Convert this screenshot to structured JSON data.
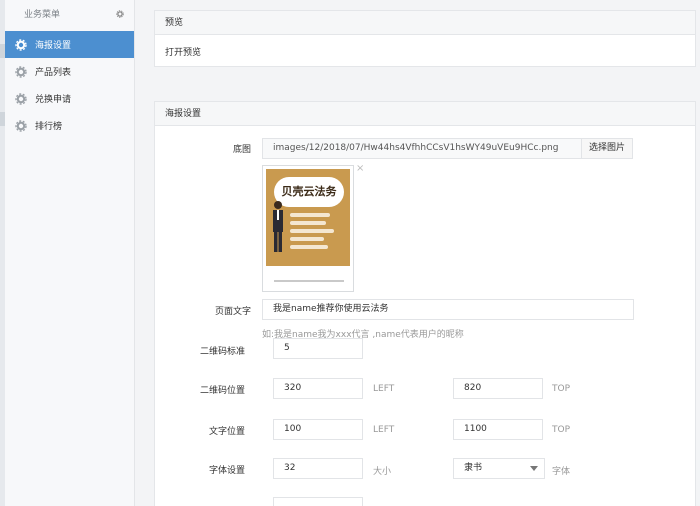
{
  "sidebar": {
    "header": "业务菜单",
    "items": [
      {
        "label": "海报设置",
        "active": true
      },
      {
        "label": "产品列表",
        "active": false
      },
      {
        "label": "兑换申请",
        "active": false
      },
      {
        "label": "排行榜",
        "active": false
      }
    ]
  },
  "preview_panel": {
    "title": "预览",
    "link": "打开预览"
  },
  "settings_panel": {
    "title": "海报设置",
    "background": {
      "label": "底图",
      "value": "images/12/2018/07/Hw44hs4VfhhCCsV1hsWY49uVEu9HCc.png",
      "button": "选择图片",
      "thumbnail_title": "贝壳云法务"
    },
    "page_text": {
      "label": "页面文字",
      "value": "我是name推荐你使用云法务",
      "help": "如:我是name我为xxx代言 ,name代表用户的昵称"
    },
    "qr_size": {
      "label": "二维码标准",
      "value": "5"
    },
    "qr_position": {
      "label": "二维码位置",
      "left_value": "320",
      "left_unit": "LEFT",
      "top_value": "820",
      "top_unit": "TOP"
    },
    "text_position": {
      "label": "文字位置",
      "left_value": "100",
      "left_unit": "LEFT",
      "top_value": "1100",
      "top_unit": "TOP"
    },
    "font_settings": {
      "label": "字体设置",
      "size_value": "32",
      "size_unit": "大小",
      "font_value": "隶书",
      "font_unit": "字体"
    }
  },
  "colors": {
    "accent": "#4c8fd0",
    "thumbnail_bg": "#c99a4f"
  }
}
